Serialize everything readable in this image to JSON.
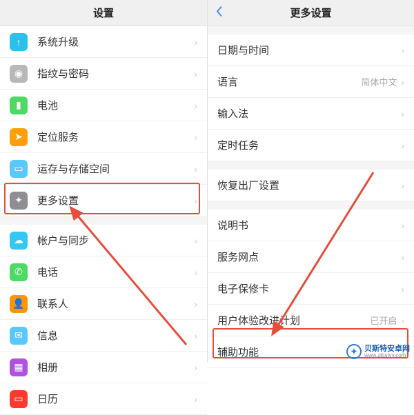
{
  "left": {
    "title": "设置",
    "items": [
      {
        "label": "系统升级",
        "iconColor": "#29c0ea",
        "icon": "↑"
      },
      {
        "label": "指纹与密码",
        "iconColor": "#b8b8b8",
        "icon": "◉"
      },
      {
        "label": "电池",
        "iconColor": "#4cd964",
        "icon": "▮"
      },
      {
        "label": "定位服务",
        "iconColor": "#ff9f0a",
        "icon": "➤"
      },
      {
        "label": "运存与存储空间",
        "iconColor": "#5ac8fa",
        "icon": "▭"
      },
      {
        "label": "更多设置",
        "iconColor": "#8e8e93",
        "icon": "✦",
        "highlight": true
      },
      {
        "label": "帐户与同步",
        "iconColor": "#34c7f4",
        "icon": "☁"
      },
      {
        "label": "电话",
        "iconColor": "#4cd964",
        "icon": "✆"
      },
      {
        "label": "联系人",
        "iconColor": "#ff9500",
        "icon": "👤"
      },
      {
        "label": "信息",
        "iconColor": "#5ac8fa",
        "icon": "✉"
      },
      {
        "label": "相册",
        "iconColor": "#af52de",
        "icon": "▦"
      },
      {
        "label": "日历",
        "iconColor": "#ff3b30",
        "icon": "▭"
      }
    ]
  },
  "right": {
    "title": "更多设置",
    "groups": [
      [
        {
          "label": "日期与时间"
        },
        {
          "label": "语言",
          "value": "简体中文"
        },
        {
          "label": "输入法"
        },
        {
          "label": "定时任务"
        }
      ],
      [
        {
          "label": "恢复出厂设置"
        }
      ],
      [
        {
          "label": "说明书"
        },
        {
          "label": "服务网点"
        },
        {
          "label": "电子保修卡"
        },
        {
          "label": "用户体验改进计划",
          "value": "已开启"
        },
        {
          "label": "辅助功能",
          "highlight": true
        }
      ]
    ]
  },
  "watermark": {
    "title": "贝斯特安卓网",
    "url": "www.zjbstyy.com"
  }
}
